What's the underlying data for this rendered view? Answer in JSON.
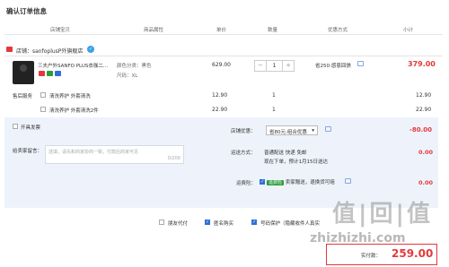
{
  "page_title": "确认订单信息",
  "columns": [
    "店铺宝贝",
    "商品属性",
    "单价",
    "数量",
    "优惠方式",
    "小计"
  ],
  "shop": {
    "label": "店铺：sanfoplusP外旗舰店"
  },
  "product": {
    "name": "三夫户外SANFO PLUS衣咖二...",
    "attr_color": "颜色分类：黑色",
    "attr_size": "尺码：XL",
    "price": "629.00",
    "quantity": "1",
    "discount": "省250:感恩回馈",
    "subtotal": "379.00"
  },
  "services": {
    "label": "售后服务",
    "items": [
      {
        "name": "清洗养护 外套清洗",
        "price": "12.90",
        "qty": "1",
        "subtotal": "12.90"
      },
      {
        "name": "清洗养护 外套清洗2件",
        "price": "22.90",
        "qty": "1",
        "subtotal": "22.90"
      }
    ]
  },
  "invoice": {
    "label": "开具发票"
  },
  "shop_discount": {
    "label": "店铺优惠：",
    "value": "省80元:组合优惠",
    "amount": "-80.00"
  },
  "message": {
    "label": "给卖家留言：",
    "placeholder": "选填，请先和商家协商一致，付款后商家可见",
    "counter": "0/200"
  },
  "shipping": {
    "label": "运送方式：",
    "line1": "普通配送 快递 免邮",
    "line2": "现在下单，预计1月15日送达",
    "amount": "0.00"
  },
  "insurance": {
    "label": "运费险：",
    "tag": "运费险",
    "text": "卖家赠送，退换货可赔",
    "amount": "0.00"
  },
  "options": [
    {
      "label": "朋友代付",
      "checked": false
    },
    {
      "label": "匿名购买",
      "checked": true
    },
    {
      "label": "号码保护（隐藏收件人真实",
      "checked": true
    }
  ],
  "total": {
    "label": "实付款：",
    "amount": "259.00"
  },
  "watermark": {
    "main": "值|回|值",
    "url": "zhizhizhi.com"
  },
  "colors": {
    "accent": "#e4393c",
    "blue": "#2f6fd6",
    "panel": "#eef3fb"
  }
}
